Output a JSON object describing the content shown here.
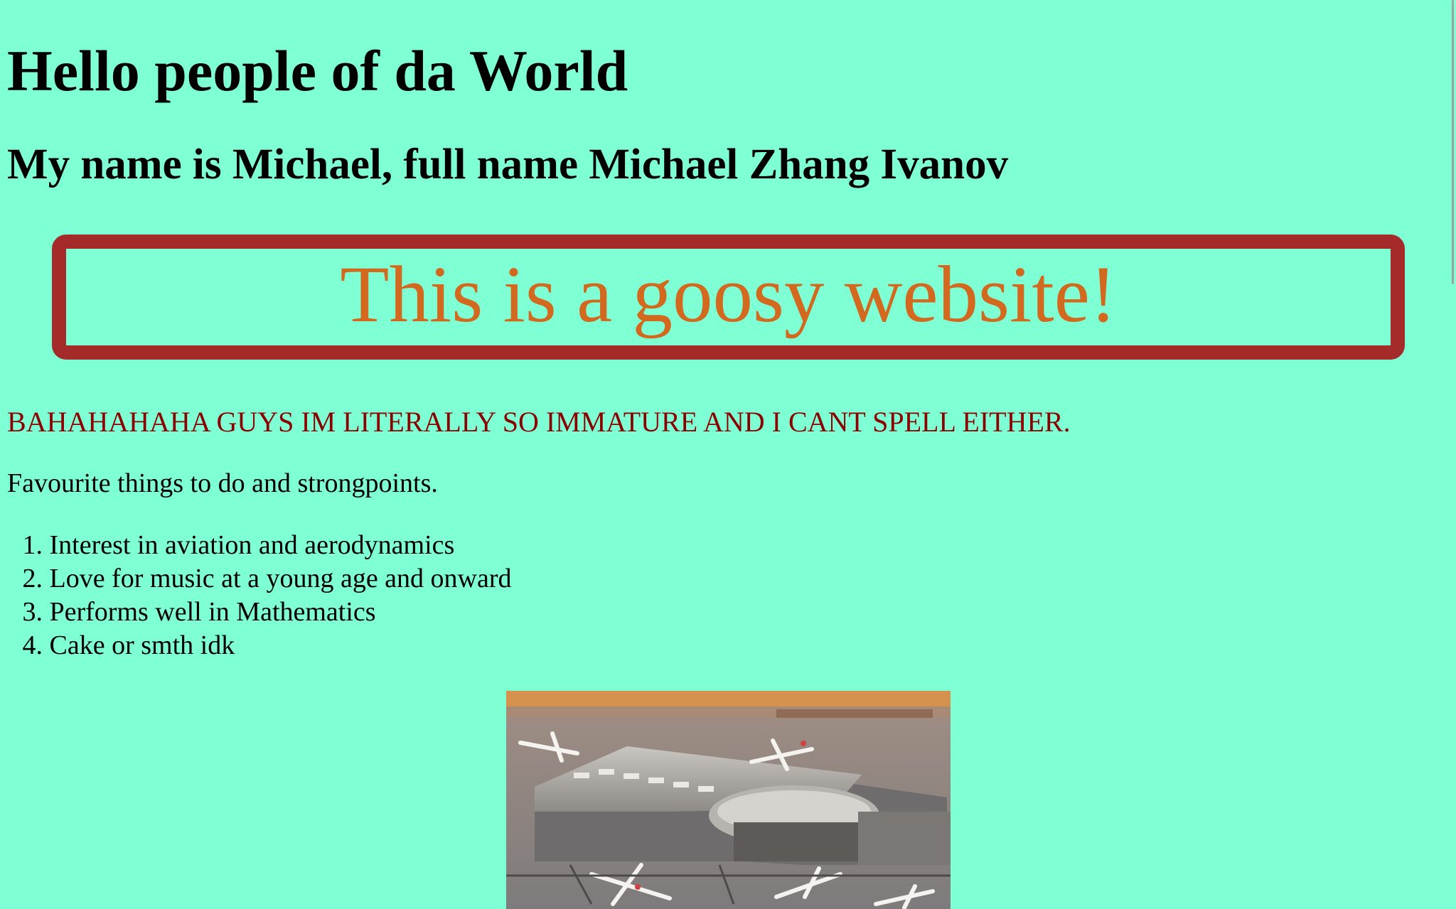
{
  "headings": {
    "greeting": "Hello people of da World",
    "name_line": "My name is Michael, full name Michael Zhang Ivanov"
  },
  "banner": {
    "text": "This is a goosy website!",
    "border_color": "#a52a2a",
    "text_color": "#d2691e"
  },
  "shout": {
    "text": "BAHAHAHAHA GUYS IM LITERALLY SO IMMATURE AND I CANT SPELL EITHER.",
    "color": "#8b0000"
  },
  "intro": "Favourite things to do and strongpoints.",
  "favorites": [
    {
      "number": "1.",
      "text": "Interest in aviation and aerodynamics"
    },
    {
      "number": "2.",
      "text": "Love for music at a young age and onward"
    },
    {
      "number": "3.",
      "text": "Performs well in Mathematics"
    },
    {
      "number": "4.",
      "text": "Cake or smth idk"
    }
  ],
  "page": {
    "background": "#7fffd4"
  },
  "image": {
    "subject": "aerial view of airport terminal with parked airplanes"
  }
}
